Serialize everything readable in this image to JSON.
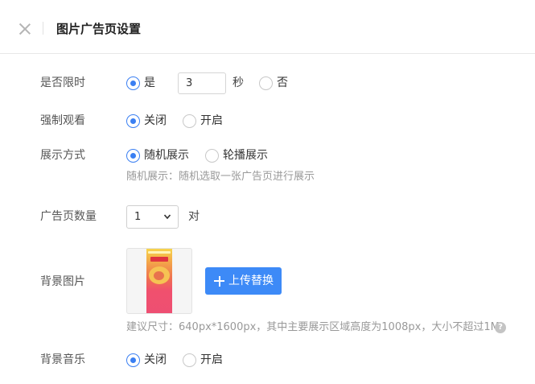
{
  "header": {
    "title": "图片广告页设置",
    "close_icon": "close-icon"
  },
  "colors": {
    "accent": "#3a7ff2",
    "button": "#3d8af7",
    "hint": "#999999"
  },
  "form": {
    "time_limit": {
      "label": "是否限时",
      "options": [
        "是",
        "否"
      ],
      "selected": "是",
      "seconds_value": "3",
      "seconds_unit": "秒"
    },
    "force_view": {
      "label": "强制观看",
      "options": [
        "关闭",
        "开启"
      ],
      "selected": "关闭"
    },
    "display_mode": {
      "label": "展示方式",
      "options": [
        "随机展示",
        "轮播展示"
      ],
      "selected": "随机展示",
      "hint": "随机展示：随机选取一张广告页进行展示"
    },
    "ad_count": {
      "label": "广告页数量",
      "selected_value": "1",
      "unit": "对"
    },
    "background_image": {
      "label": "背景图片",
      "upload_label": "上传替换",
      "hint": "建议尺寸：640px*1600px，其中主要展示区域高度为1008px，大小不超过1M",
      "help_icon": "question-circle-icon"
    },
    "background_music": {
      "label": "背景音乐",
      "options": [
        "关闭",
        "开启"
      ],
      "selected": "关闭"
    }
  }
}
